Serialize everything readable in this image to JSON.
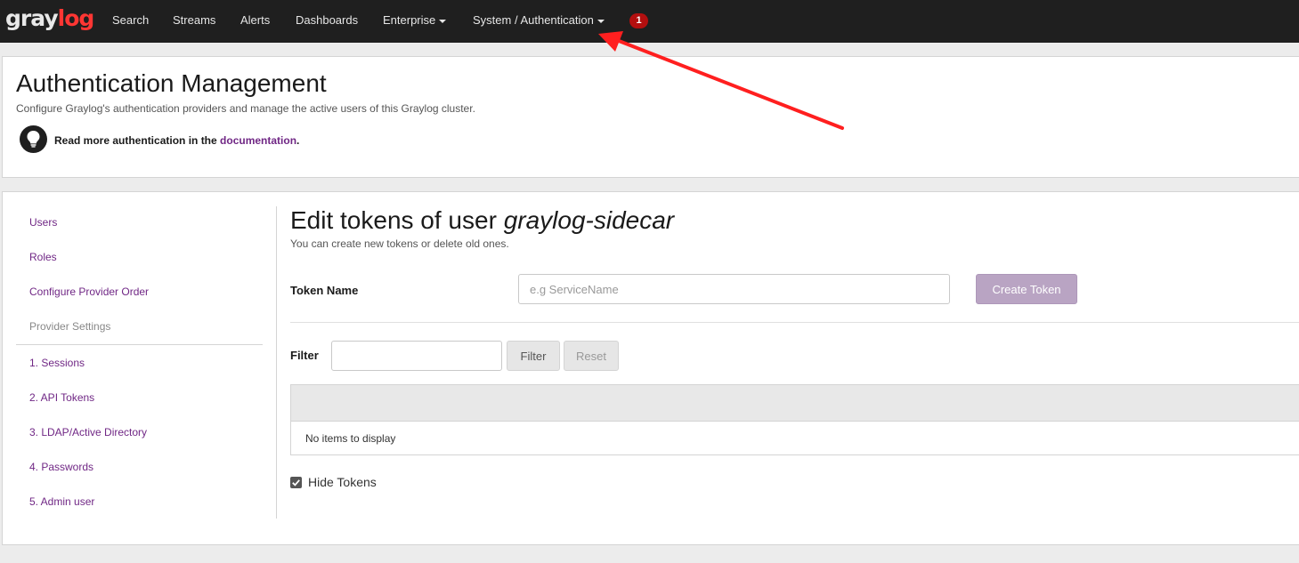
{
  "nav": {
    "logo_gray": "gray",
    "logo_log": "log",
    "items": [
      {
        "label": "Search"
      },
      {
        "label": "Streams"
      },
      {
        "label": "Alerts"
      },
      {
        "label": "Dashboards"
      },
      {
        "label": "Enterprise"
      },
      {
        "label": "System / Authentication"
      }
    ],
    "notification_count": "1"
  },
  "header": {
    "title": "Authentication Management",
    "description": "Configure Graylog's authentication providers and manage the active users of this Graylog cluster.",
    "docs_prefix": "Read more authentication in the ",
    "docs_link": "documentation",
    "docs_suffix": "."
  },
  "sidebar": {
    "items": [
      {
        "label": "Users"
      },
      {
        "label": "Roles"
      },
      {
        "label": "Configure Provider Order"
      }
    ],
    "section_header": "Provider Settings",
    "providers": [
      {
        "label": "1. Sessions"
      },
      {
        "label": "2. API Tokens"
      },
      {
        "label": "3. LDAP/Active Directory"
      },
      {
        "label": "4. Passwords"
      },
      {
        "label": "5. Admin user"
      }
    ]
  },
  "content": {
    "title_prefix": "Edit tokens of user ",
    "title_user": "graylog-sidecar",
    "description": "You can create new tokens or delete old ones.",
    "token_label": "Token Name",
    "token_placeholder": "e.g ServiceName",
    "create_button": "Create Token",
    "filter_label": "Filter",
    "filter_value": "",
    "filter_button": "Filter",
    "reset_button": "Reset",
    "empty_text": "No items to display",
    "hide_tokens_label": "Hide Tokens",
    "hide_tokens_checked": true
  },
  "colors": {
    "navbar": "#1f1f1f",
    "brand_red": "#ff3633",
    "link_purple": "#702785",
    "badge_red": "#b30f0f",
    "annotation_arrow": "#ff1f1f"
  },
  "icons": [
    "lightbulb-icon",
    "caret-down-icon",
    "checkmark-icon",
    "annotation-arrow"
  ]
}
